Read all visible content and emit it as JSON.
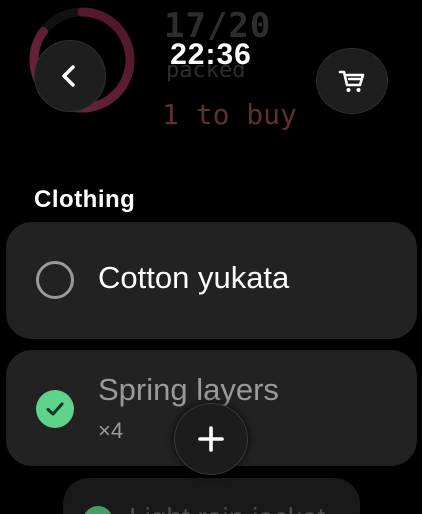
{
  "status": {
    "time": "22:36"
  },
  "summary": {
    "count": "17/20",
    "packed_label": "packed",
    "to_buy": "1 to buy",
    "progress": 0.85
  },
  "header": {
    "back_icon": "chevron-left-icon",
    "cart_icon": "shopping-cart-icon"
  },
  "section": {
    "title": "Clothing"
  },
  "items": [
    {
      "name": "Cotton yukata",
      "checked": false
    },
    {
      "name": "Spring layers",
      "quantity": "×4",
      "checked": true
    },
    {
      "name": "Light rain jacket",
      "checked": true
    }
  ],
  "fab": {
    "icon": "plus-icon"
  },
  "colors": {
    "background": "#000000",
    "card": "#222222",
    "check": "#5ed38a",
    "accent_ring": "#e0457a",
    "to_buy": "#d97a6a"
  }
}
